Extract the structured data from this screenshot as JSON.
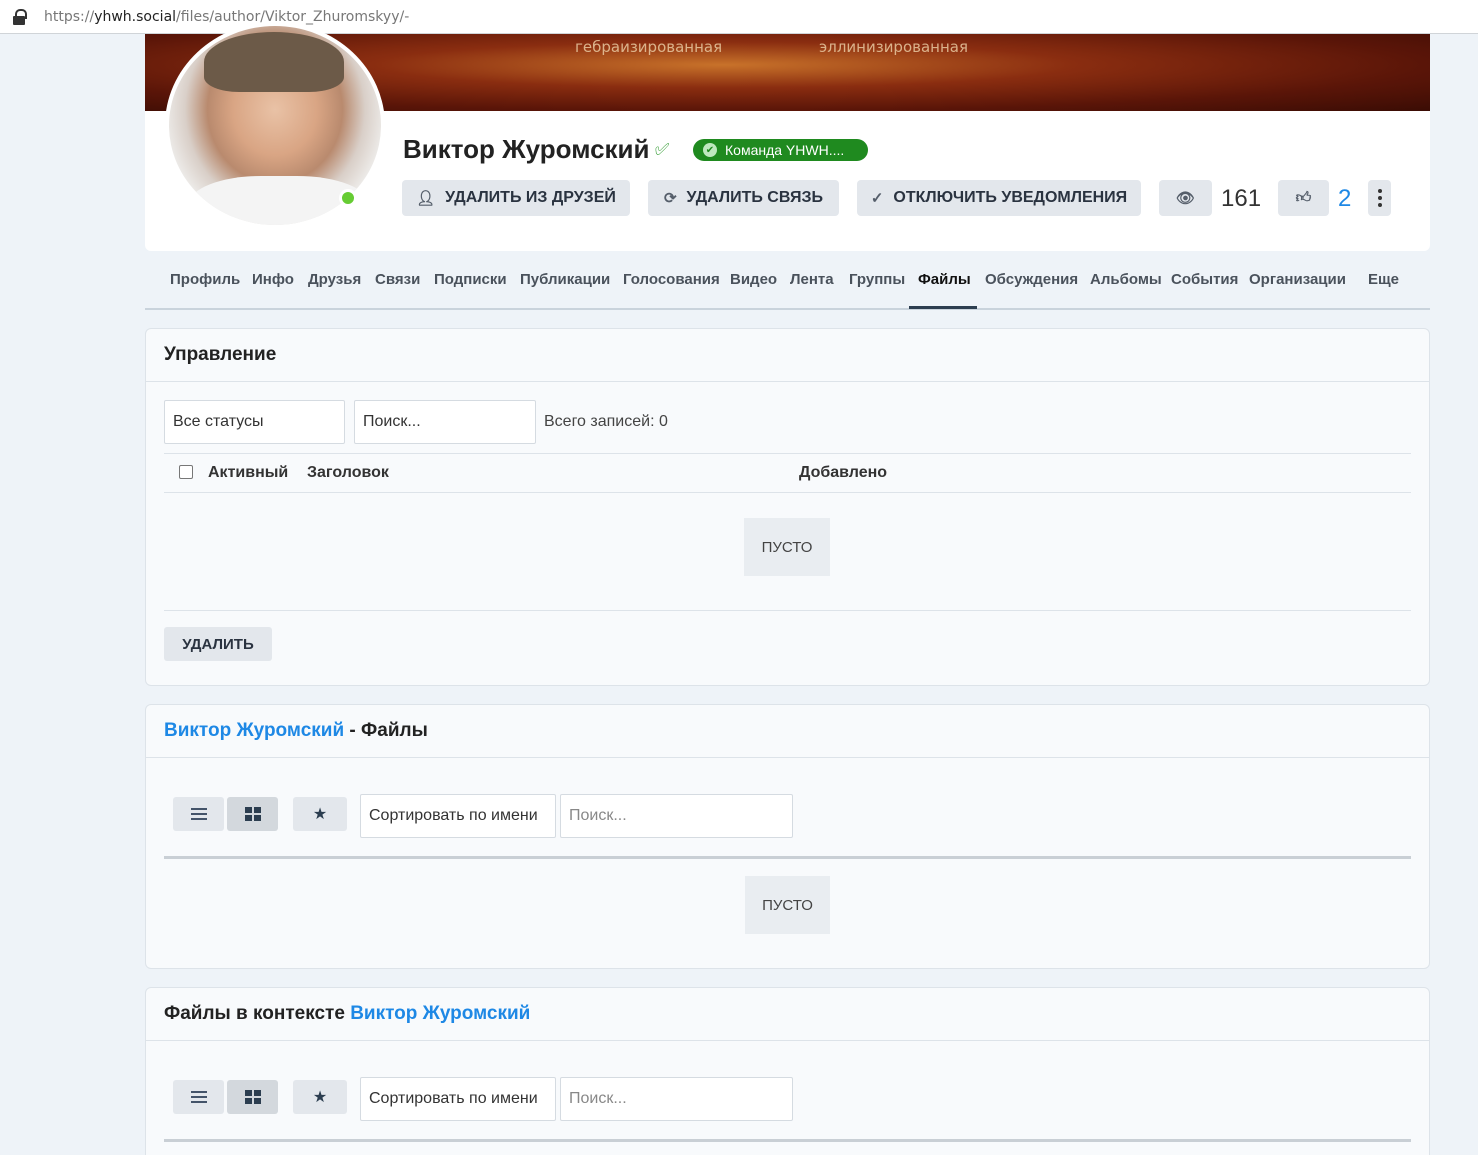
{
  "browser": {
    "url_prefix": "https://",
    "url_domain": "yhwh.social",
    "url_path": "/files/author/Viktor_Zhuromskyy/-"
  },
  "cover": {
    "word_left": "гебраизированная",
    "word_right": "эллинизированная"
  },
  "profile": {
    "name": "Виктор Журомский",
    "team_badge": "Команда YHWH....",
    "actions": {
      "unfriend": "Удалить из друзей",
      "remove_connection": "Удалить связь",
      "disable_notifications": "Отключить уведомления"
    },
    "views_count": "161",
    "likes_count": "2",
    "colors": {
      "online": "#66cc33",
      "badge": "#1f8a1f",
      "accent": "#1e88e5"
    }
  },
  "tabs": [
    {
      "label": "Профиль"
    },
    {
      "label": "Инфо"
    },
    {
      "label": "Друзья"
    },
    {
      "label": "Связи"
    },
    {
      "label": "Подписки"
    },
    {
      "label": "Публикации"
    },
    {
      "label": "Голосования"
    },
    {
      "label": "Видео"
    },
    {
      "label": "Лента"
    },
    {
      "label": "Группы"
    },
    {
      "label": "Файлы"
    },
    {
      "label": "Обсуждения"
    },
    {
      "label": "Альбомы"
    },
    {
      "label": "События"
    },
    {
      "label": "Организации"
    },
    {
      "label": "Еще"
    }
  ],
  "manage": {
    "title": "Управление",
    "status_select": "Все статусы",
    "search_placeholder": "Поиск...",
    "total": "Всего записей: 0",
    "columns": {
      "active": "Активный",
      "title": "Заголовок",
      "added": "Добавлено"
    },
    "empty": "Пусто",
    "delete_label": "Удалить"
  },
  "files": {
    "author_link": "Виктор Журомский",
    "title_suffix": " - Файлы",
    "sort_label": "Сортировать по имени",
    "search_placeholder": "Поиск...",
    "empty": "Пусто"
  },
  "context": {
    "title_prefix": "Файлы в контексте ",
    "author_link": "Виктор Журомский",
    "sort_label": "Сортировать по имени",
    "search_placeholder": "Поиск..."
  }
}
